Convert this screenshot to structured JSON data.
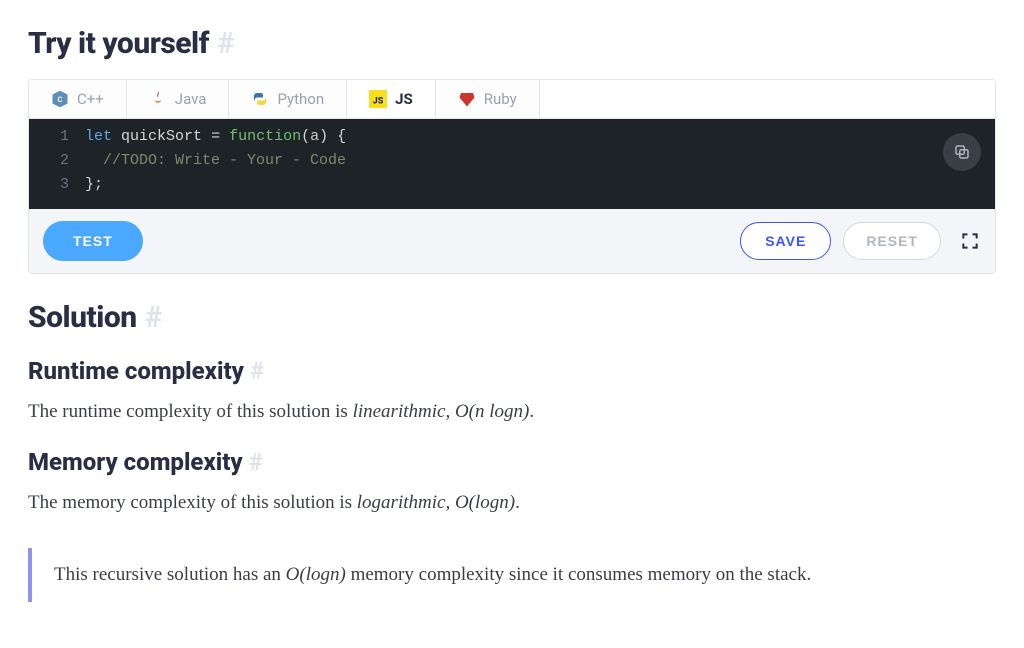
{
  "headings": {
    "try": "Try it yourself",
    "solution": "Solution",
    "runtime": "Runtime complexity",
    "memory": "Memory complexity",
    "hash": "#"
  },
  "tabs": [
    {
      "label": "C++",
      "icon": "cpp-icon"
    },
    {
      "label": "Java",
      "icon": "java-icon"
    },
    {
      "label": "Python",
      "icon": "python-icon"
    },
    {
      "label": "JS",
      "icon": "js-icon"
    },
    {
      "label": "Ruby",
      "icon": "ruby-icon"
    }
  ],
  "active_tab": "JS",
  "code": {
    "lines": [
      {
        "n": "1",
        "tokens": [
          "let",
          " ",
          "quickSort",
          " ",
          "=",
          " ",
          "function",
          "(",
          "a",
          ")",
          " ",
          "{"
        ]
      },
      {
        "n": "2",
        "comment": "  //TODO: Write - Your - Code"
      },
      {
        "n": "3",
        "close": "};"
      }
    ]
  },
  "toolbar": {
    "test": "TEST",
    "save": "SAVE",
    "reset": "RESET"
  },
  "body": {
    "runtime_pre": "The runtime complexity of this solution is ",
    "runtime_em": "linearithmic,",
    "runtime_math": " O(n logn)",
    "runtime_post": ".",
    "memory_pre": "The memory complexity of this solution is ",
    "memory_em": "logarithmic,",
    "memory_math": " O(logn)",
    "memory_post": ".",
    "callout_pre": "This recursive solution has an ",
    "callout_math": "O(logn)",
    "callout_post": " memory complexity since it consumes memory on the stack."
  }
}
